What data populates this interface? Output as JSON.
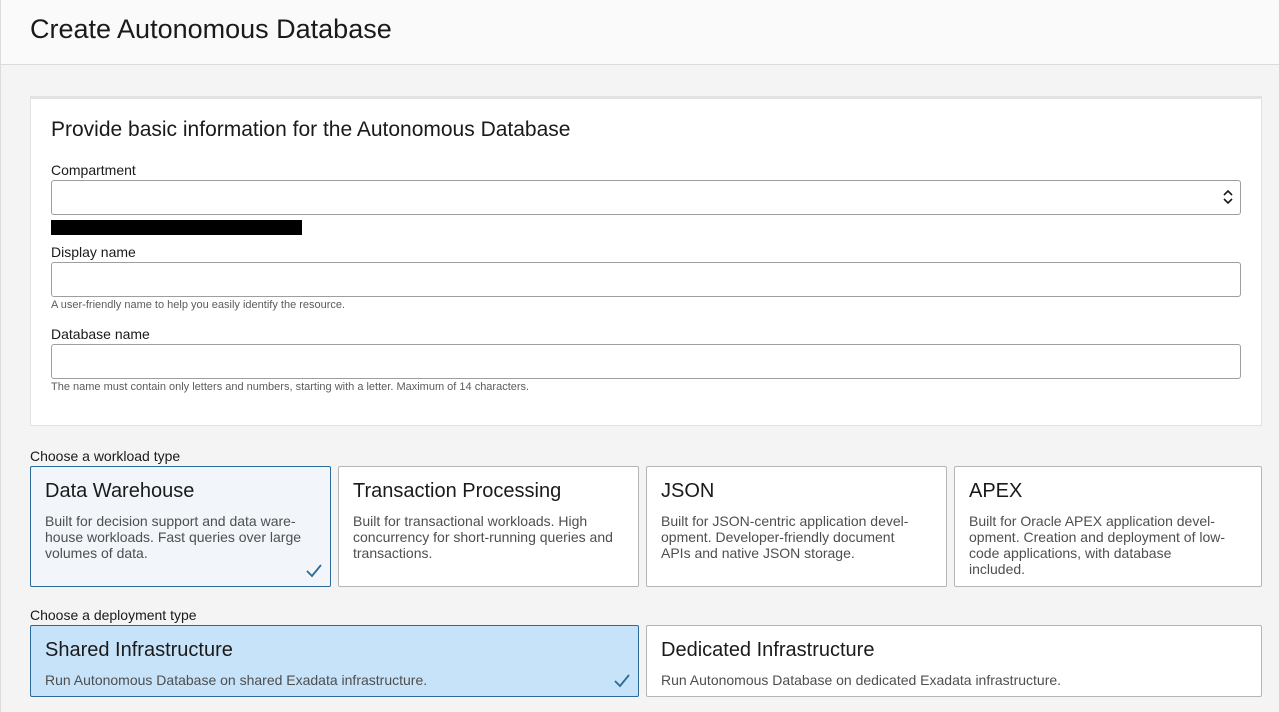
{
  "page": {
    "title": "Create Autonomous Database"
  },
  "basic_info": {
    "title": "Provide basic information for the Autonomous Database",
    "compartment": {
      "label": "Compartment",
      "value": ""
    },
    "display_name": {
      "label": "Display name",
      "value": "",
      "helper": "A user-friendly name to help you easily identify the resource."
    },
    "database_name": {
      "label": "Database name",
      "value": "",
      "helper": "The name must contain only letters and numbers, starting with a letter. Maximum of 14 characters."
    }
  },
  "workload": {
    "label": "Choose a workload type",
    "options": [
      {
        "title": "Data Warehouse",
        "desc": "Built for decision support and data ware-house workloads. Fast queries over large volumes of data.",
        "selected": true
      },
      {
        "title": "Transaction Processing",
        "desc": "Built for transactional workloads. High concurrency for short-running queries and transactions.",
        "selected": false
      },
      {
        "title": "JSON",
        "desc": "Built for JSON-centric application devel-opment. Developer-friendly document APIs and native JSON storage.",
        "selected": false
      },
      {
        "title": "APEX",
        "desc": "Built for Oracle APEX application devel-opment. Creation and deployment of low-code applications, with database included.",
        "selected": false
      }
    ]
  },
  "deployment": {
    "label": "Choose a deployment type",
    "options": [
      {
        "title": "Shared Infrastructure",
        "desc": "Run Autonomous Database on shared Exadata infrastructure.",
        "selected": true
      },
      {
        "title": "Dedicated Infrastructure",
        "desc": "Run Autonomous Database on dedicated Exadata infrastructure.",
        "selected": false
      }
    ]
  },
  "colors": {
    "accent": "#2b6a99",
    "selected_fill": "#c7e3f9",
    "selected_light_fill": "#f2f6fa",
    "check": "#2b6a99"
  }
}
